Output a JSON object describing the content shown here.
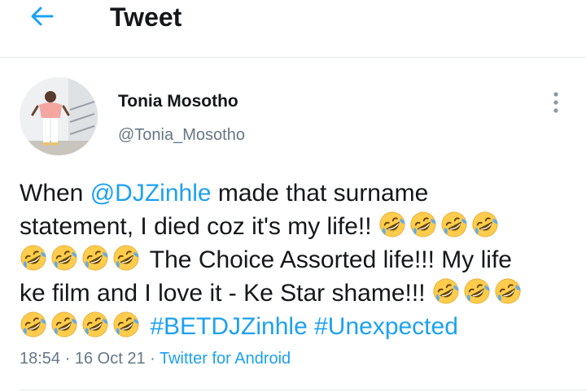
{
  "header": {
    "title": "Tweet",
    "back_icon": "arrow-left-icon"
  },
  "author": {
    "name": "Tonia Mosotho",
    "handle": "@Tonia_Mosotho",
    "more_icon": "more-vertical-icon"
  },
  "tweet": {
    "line1_pre": "When ",
    "mention": "@DJZinhle",
    "line1_post": " made that surname",
    "line2": "statement, I died coz it's my life!! ",
    "line3": "The Choice Assorted life!!! My life",
    "line4": "ke film and I love it - Ke Star shame!!! ",
    "hashtag1": "#BETDJZinhle",
    "hashtag2": "#Unexpected",
    "emoji": "rolling-on-floor-laughing-emoji"
  },
  "meta": {
    "time": "18:54",
    "sep1": " · ",
    "date": "16 Oct 21",
    "sep2": " · ",
    "source": "Twitter for Android"
  },
  "colors": {
    "accent": "#1da1f2",
    "text": "#14171a",
    "secondary": "#657786",
    "divider": "#e1e8ed"
  }
}
